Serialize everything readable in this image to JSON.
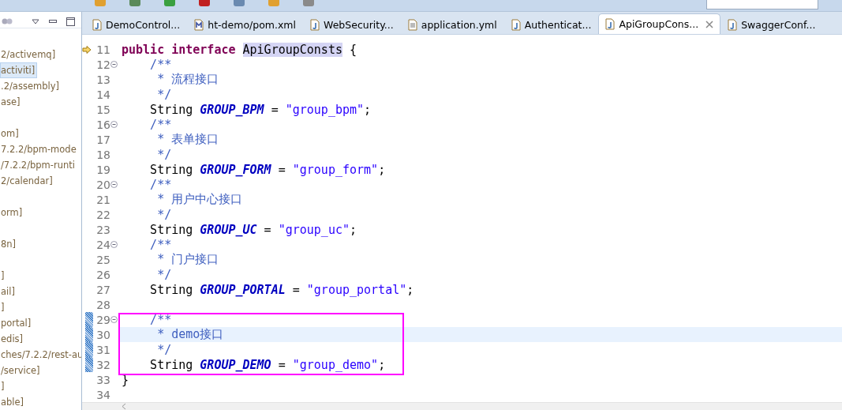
{
  "sidebar": {
    "groups": [
      [
        {
          "text": "2/activemq]",
          "selected": false
        },
        {
          "text": "activiti]",
          "selected": true
        },
        {
          "text": ".2/assembly]",
          "selected": false
        },
        {
          "text": "ase]",
          "selected": false
        }
      ],
      [
        {
          "text": "om]",
          "selected": false
        },
        {
          "text": "7.2.2/bpm-mode",
          "selected": false
        },
        {
          "text": "/7.2.2/bpm-runti",
          "selected": false
        },
        {
          "text": "2/calendar]",
          "selected": false
        }
      ],
      [
        {
          "text": "orm]",
          "selected": false
        }
      ],
      [
        {
          "text": "8n]",
          "selected": false
        }
      ],
      [
        {
          "text": "]",
          "selected": false
        },
        {
          "text": "ail]",
          "selected": false
        },
        {
          "text": "]",
          "selected": false
        },
        {
          "text": "portal]",
          "selected": false
        },
        {
          "text": "edis]",
          "selected": false
        },
        {
          "text": "ches/7.2.2/rest-au",
          "selected": false
        },
        {
          "text": "/service]",
          "selected": false
        },
        {
          "text": "]",
          "selected": false
        },
        {
          "text": "able]",
          "selected": false
        }
      ]
    ]
  },
  "tabs": [
    {
      "label": "DemoControl...",
      "kind": "java",
      "selected": false
    },
    {
      "label": "ht-demo/pom.xml",
      "kind": "maven",
      "selected": false
    },
    {
      "label": "WebSecurity...",
      "kind": "java",
      "selected": false
    },
    {
      "label": "application.yml",
      "kind": "text",
      "selected": false
    },
    {
      "label": "Authenticat...",
      "kind": "java",
      "selected": false
    },
    {
      "label": "ApiGroupCons...",
      "kind": "java",
      "selected": true
    },
    {
      "label": "SwaggerConf...",
      "kind": "java",
      "selected": false
    }
  ],
  "editor": {
    "lines": [
      {
        "number": "11",
        "marker": true,
        "fold": false,
        "changed": false,
        "current": false,
        "boxed": false,
        "tokens": [
          {
            "kind": "keyword",
            "text": "public "
          },
          {
            "kind": "keyword",
            "text": "interface "
          },
          {
            "kind": "occurrence",
            "text": "ApiGroupConsts"
          },
          {
            "kind": "plain",
            "text": " {"
          }
        ]
      },
      {
        "number": "12",
        "marker": false,
        "fold": true,
        "changed": false,
        "current": false,
        "boxed": false,
        "tokens": [
          {
            "kind": "comment",
            "text": "    /**"
          }
        ]
      },
      {
        "number": "13",
        "marker": false,
        "fold": false,
        "changed": false,
        "current": false,
        "boxed": false,
        "tokens": [
          {
            "kind": "comment",
            "text": "     * 流程接口"
          }
        ]
      },
      {
        "number": "14",
        "marker": false,
        "fold": false,
        "changed": false,
        "current": false,
        "boxed": false,
        "tokens": [
          {
            "kind": "comment",
            "text": "     */"
          }
        ]
      },
      {
        "number": "15",
        "marker": false,
        "fold": false,
        "changed": false,
        "current": false,
        "boxed": false,
        "tokens": [
          {
            "kind": "plain",
            "text": "    String "
          },
          {
            "kind": "constant",
            "text": "GROUP_BPM"
          },
          {
            "kind": "plain",
            "text": " = "
          },
          {
            "kind": "string",
            "text": "\"group_bpm\""
          },
          {
            "kind": "plain",
            "text": ";"
          }
        ]
      },
      {
        "number": "16",
        "marker": false,
        "fold": true,
        "changed": false,
        "current": false,
        "boxed": false,
        "tokens": [
          {
            "kind": "comment",
            "text": "    /**"
          }
        ]
      },
      {
        "number": "17",
        "marker": false,
        "fold": false,
        "changed": false,
        "current": false,
        "boxed": false,
        "tokens": [
          {
            "kind": "comment",
            "text": "     * 表单接口"
          }
        ]
      },
      {
        "number": "18",
        "marker": false,
        "fold": false,
        "changed": false,
        "current": false,
        "boxed": false,
        "tokens": [
          {
            "kind": "comment",
            "text": "     */"
          }
        ]
      },
      {
        "number": "19",
        "marker": false,
        "fold": false,
        "changed": false,
        "current": false,
        "boxed": false,
        "tokens": [
          {
            "kind": "plain",
            "text": "    String "
          },
          {
            "kind": "constant",
            "text": "GROUP_FORM"
          },
          {
            "kind": "plain",
            "text": " = "
          },
          {
            "kind": "string",
            "text": "\"group_form\""
          },
          {
            "kind": "plain",
            "text": ";"
          }
        ]
      },
      {
        "number": "20",
        "marker": false,
        "fold": true,
        "changed": false,
        "current": false,
        "boxed": false,
        "tokens": [
          {
            "kind": "comment",
            "text": "    /**"
          }
        ]
      },
      {
        "number": "21",
        "marker": false,
        "fold": false,
        "changed": false,
        "current": false,
        "boxed": false,
        "tokens": [
          {
            "kind": "comment",
            "text": "     * 用户中心接口"
          }
        ]
      },
      {
        "number": "22",
        "marker": false,
        "fold": false,
        "changed": false,
        "current": false,
        "boxed": false,
        "tokens": [
          {
            "kind": "comment",
            "text": "     */"
          }
        ]
      },
      {
        "number": "23",
        "marker": false,
        "fold": false,
        "changed": false,
        "current": false,
        "boxed": false,
        "tokens": [
          {
            "kind": "plain",
            "text": "    String "
          },
          {
            "kind": "constant",
            "text": "GROUP_UC"
          },
          {
            "kind": "plain",
            "text": " = "
          },
          {
            "kind": "string",
            "text": "\"group_uc\""
          },
          {
            "kind": "plain",
            "text": ";"
          }
        ]
      },
      {
        "number": "24",
        "marker": false,
        "fold": true,
        "changed": false,
        "current": false,
        "boxed": false,
        "tokens": [
          {
            "kind": "comment",
            "text": "    /**"
          }
        ]
      },
      {
        "number": "25",
        "marker": false,
        "fold": false,
        "changed": false,
        "current": false,
        "boxed": false,
        "tokens": [
          {
            "kind": "comment",
            "text": "     * 门户接口"
          }
        ]
      },
      {
        "number": "26",
        "marker": false,
        "fold": false,
        "changed": false,
        "current": false,
        "boxed": false,
        "tokens": [
          {
            "kind": "comment",
            "text": "     */"
          }
        ]
      },
      {
        "number": "27",
        "marker": false,
        "fold": false,
        "changed": false,
        "current": false,
        "boxed": false,
        "tokens": [
          {
            "kind": "plain",
            "text": "    String "
          },
          {
            "kind": "constant",
            "text": "GROUP_PORTAL"
          },
          {
            "kind": "plain",
            "text": " = "
          },
          {
            "kind": "string",
            "text": "\"group_portal\""
          },
          {
            "kind": "plain",
            "text": ";"
          }
        ]
      },
      {
        "number": "28",
        "marker": false,
        "fold": false,
        "changed": false,
        "current": false,
        "boxed": false
      },
      {
        "number": "29",
        "marker": false,
        "fold": true,
        "changed": true,
        "current": false,
        "boxed": true,
        "tokens": [
          {
            "kind": "comment",
            "text": "    /**"
          }
        ]
      },
      {
        "number": "30",
        "marker": false,
        "fold": false,
        "changed": true,
        "current": true,
        "boxed": true,
        "tokens": [
          {
            "kind": "comment",
            "text": "     * demo接口"
          }
        ]
      },
      {
        "number": "31",
        "marker": false,
        "fold": false,
        "changed": true,
        "current": false,
        "boxed": true,
        "tokens": [
          {
            "kind": "comment",
            "text": "     */"
          }
        ]
      },
      {
        "number": "32",
        "marker": false,
        "fold": false,
        "changed": true,
        "current": false,
        "boxed": true,
        "tokens": [
          {
            "kind": "plain",
            "text": "    String "
          },
          {
            "kind": "constant",
            "text": "GROUP_DEMO"
          },
          {
            "kind": "plain",
            "text": " = "
          },
          {
            "kind": "string",
            "text": "\"group_demo\""
          },
          {
            "kind": "plain",
            "text": ";"
          }
        ]
      },
      {
        "number": "33",
        "marker": false,
        "fold": false,
        "changed": false,
        "current": false,
        "boxed": false,
        "tokens": [
          {
            "kind": "plain",
            "text": "}"
          }
        ]
      },
      {
        "number": "34",
        "marker": false,
        "fold": false,
        "changed": false,
        "current": false,
        "boxed": false
      }
    ]
  }
}
